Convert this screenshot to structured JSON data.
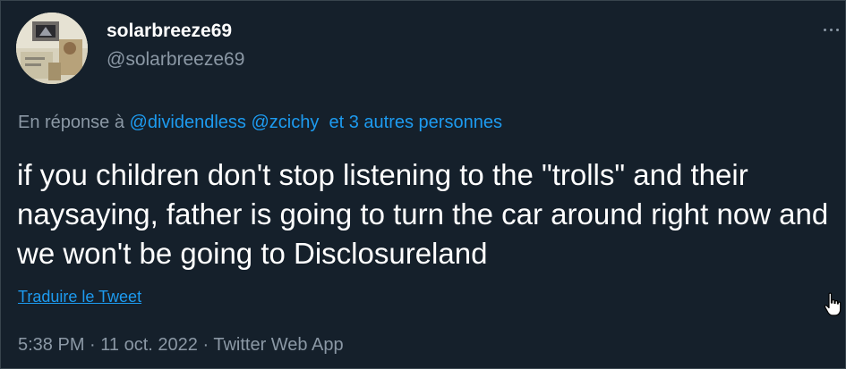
{
  "tweet": {
    "display_name": "solarbreeze69",
    "handle": "@solarbreeze69",
    "reply": {
      "prefix": "En réponse à",
      "mention_1": "@dividendless",
      "mention_2": "@zcichy",
      "others": "et 3 autres personnes"
    },
    "text": "if you children don't stop listening to the \"trolls\" and their naysaying, father is going to turn the car around right now and we won't be going to Disclosureland",
    "translate_label": "Traduire le Tweet",
    "time": "5:38 PM",
    "date": "11 oct. 2022",
    "source": "Twitter Web App",
    "separator": "·"
  },
  "icons": {
    "more": "more-horizontal-icon",
    "cursor": "hand-pointer-cursor-icon"
  },
  "colors": {
    "background": "#15202b",
    "link": "#1d9bf0",
    "secondary_text": "#8b98a5",
    "primary_text": "#ffffff"
  }
}
